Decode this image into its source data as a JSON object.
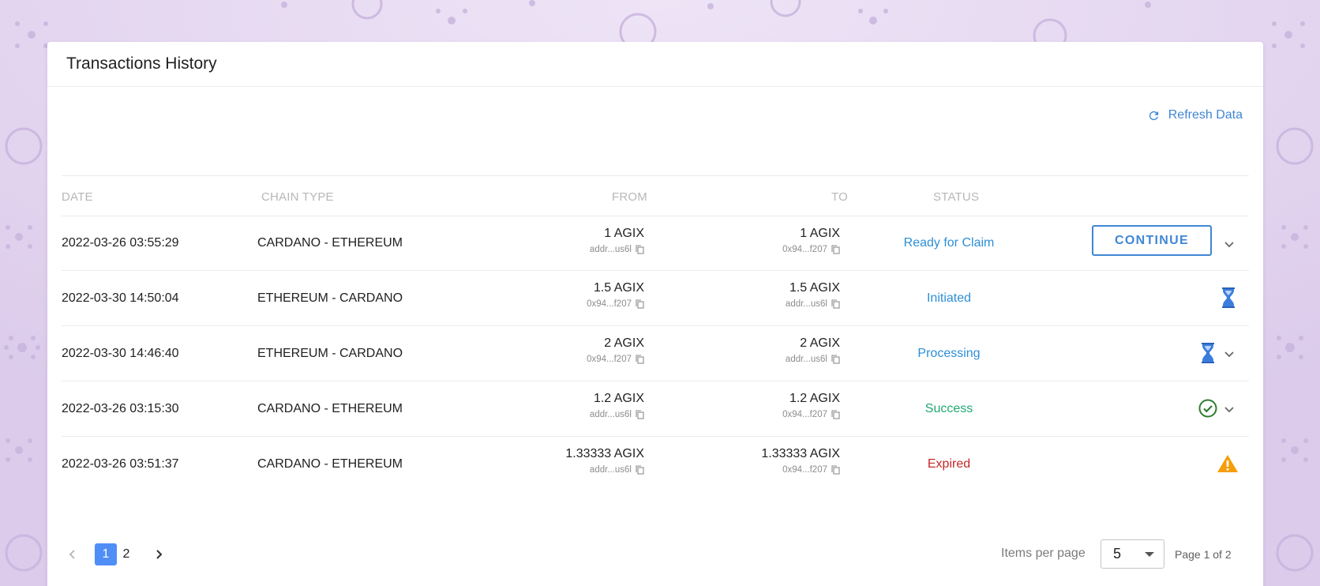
{
  "card": {
    "title": "Transactions History",
    "refresh_label": "Refresh Data"
  },
  "table": {
    "headers": {
      "date": "DATE",
      "chain_type": "CHAIN TYPE",
      "from": "FROM",
      "to": "TO",
      "status": "STATUS"
    },
    "rows": [
      {
        "date": "2022-03-26 03:55:29",
        "chain": "CARDANO - ETHEREUM",
        "from_amount": "1 AGIX",
        "from_addr": "addr...us6l",
        "to_amount": "1 AGIX",
        "to_addr": "0x94...f207",
        "status": "Ready for Claim",
        "status_color": "#2d8fd6",
        "action_label": "CONTINUE",
        "action_icon": "chevron-down-icon"
      },
      {
        "date": "2022-03-30 14:50:04",
        "chain": "ETHEREUM - CARDANO",
        "from_amount": "1.5 AGIX",
        "from_addr": "0x94...f207",
        "to_amount": "1.5 AGIX",
        "to_addr": "addr...us6l",
        "status": "Initiated",
        "status_color": "#2d8fd6",
        "action_icon": "hourglass-icon"
      },
      {
        "date": "2022-03-30 14:46:40",
        "chain": "ETHEREUM - CARDANO",
        "from_amount": "2 AGIX",
        "from_addr": "0x94...f207",
        "to_amount": "2 AGIX",
        "to_addr": "addr...us6l",
        "status": "Processing",
        "status_color": "#2d8fd6",
        "action_icon": "hourglass-icon"
      },
      {
        "date": "2022-03-26 03:15:30",
        "chain": "CARDANO - ETHEREUM",
        "from_amount": "1.2 AGIX",
        "from_addr": "addr...us6l",
        "to_amount": "1.2 AGIX",
        "to_addr": "0x94...f207",
        "status": "Success",
        "status_color": "#22a873",
        "action_icon": "check-circle-icon"
      },
      {
        "date": "2022-03-26 03:51:37",
        "chain": "CARDANO - ETHEREUM",
        "from_amount": "1.33333 AGIX",
        "from_addr": "addr...us6l",
        "to_amount": "1.33333 AGIX",
        "to_addr": "0x94...f207",
        "status": "Expired",
        "status_color": "#c62828",
        "action_icon": "warning-icon"
      }
    ]
  },
  "pagination": {
    "pages": [
      "1",
      "2"
    ],
    "current_page": "1",
    "items_per_page_label": "Items per page",
    "items_per_page_value": "5",
    "page_info": "Page 1 of 2"
  },
  "colors": {
    "accent": "#4086d4",
    "page_active": "#4f8ef7",
    "background": "#e3d6ef",
    "warning": "#f59e0b",
    "success_icon": "#2e7d32"
  }
}
